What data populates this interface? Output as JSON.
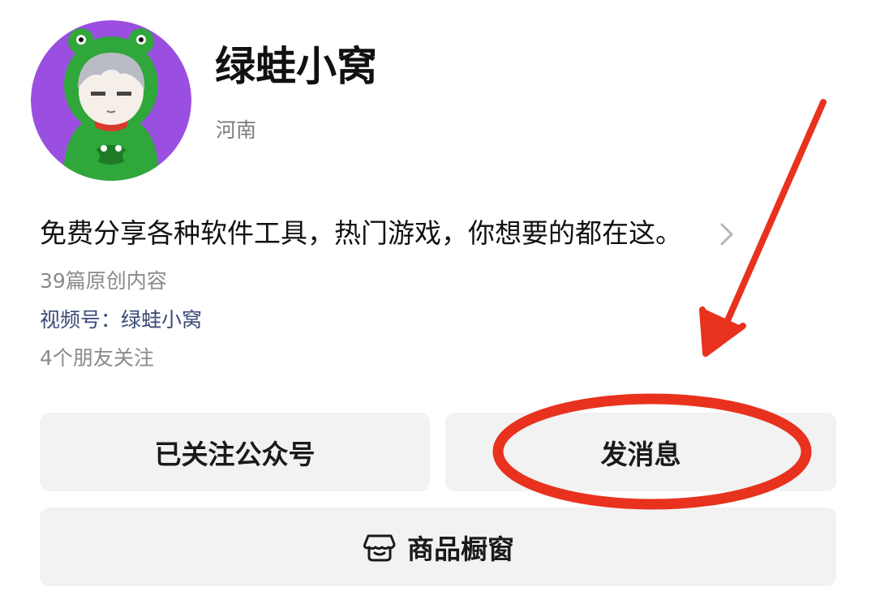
{
  "profile": {
    "avatar_icon": "frog-hood-character-avatar",
    "avatar_bg_color": "#9b4fe0",
    "name": "绿蛙小窝",
    "region": "河南",
    "intro": "免费分享各种软件工具，热门游戏，你想要的都在这。",
    "chevron_icon": "chevron-right-icon",
    "original_count_text": "39篇原创内容",
    "video_channel_text": "视频号：绿蛙小窝",
    "friends_following_text": "4个朋友关注"
  },
  "actions": {
    "follow_label": "已关注公众号",
    "message_label": "发消息",
    "shop_label": "商品橱窗",
    "shop_icon": "storefront-icon"
  },
  "annotation": {
    "color": "#e8321e",
    "shapes": [
      "arrow",
      "ellipse"
    ]
  }
}
